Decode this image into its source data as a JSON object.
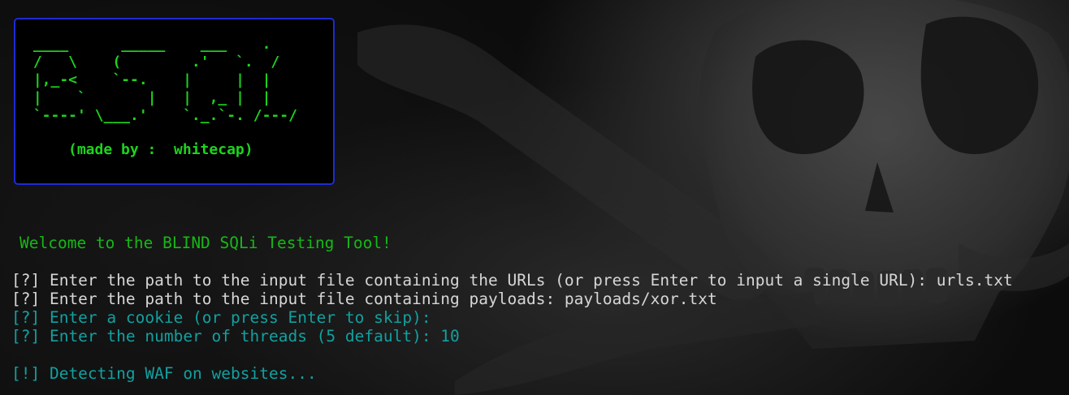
{
  "banner": {
    "ascii_lines": [
      " ____      _____    ___    .",
      " /   \\    (        .'   `.  /",
      " |,_-<    `--.    |     |  |",
      " |    `       |   |  ,_ |  |",
      " `----' \\___.'    `._.`-. /---/"
    ],
    "credit": "(made by :  whitecap)"
  },
  "terminal": {
    "welcome": "Welcome to the BLIND SQLi Testing Tool!",
    "prompts": [
      {
        "text": "[?] Enter the path to the input file containing the URLs (or press Enter to input a single URL): urls.txt",
        "color": "#d6d6d6"
      },
      {
        "text": "[?] Enter the path to the input file containing payloads: payloads/xor.txt",
        "color": "#d6d6d6"
      },
      {
        "text": "[?] Enter a cookie (or press Enter to skip):",
        "color": "#12a0a0"
      },
      {
        "text": "[?] Enter the number of threads (5 default): 10",
        "color": "#12a0a0"
      }
    ],
    "status": "[!] Detecting WAF on websites..."
  },
  "colors": {
    "ascii_green": "#1cd41c",
    "welcome_green": "#16b816",
    "prompt_white": "#d6d6d6",
    "prompt_cyan": "#12a0a0",
    "banner_border": "#1f2bd4"
  }
}
